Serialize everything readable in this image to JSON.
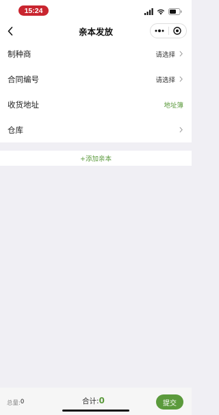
{
  "status": {
    "time": "15:24"
  },
  "nav": {
    "title": "亲本发放"
  },
  "form": {
    "producer": {
      "label": "制种商",
      "value": "请选择"
    },
    "contract": {
      "label": "合同编号",
      "value": "请选择"
    },
    "address": {
      "label": "收货地址",
      "link": "地址簿"
    },
    "warehouse": {
      "label": "仓库"
    }
  },
  "add_parent": {
    "label": "+添加亲本"
  },
  "footer": {
    "total_qty_label": "总量:",
    "total_qty_value": "0",
    "sum_label": "合计:",
    "sum_value": "0",
    "submit_label": "提交"
  },
  "colors": {
    "accent": "#5b9a3c",
    "time_pill": "#c9252f"
  }
}
